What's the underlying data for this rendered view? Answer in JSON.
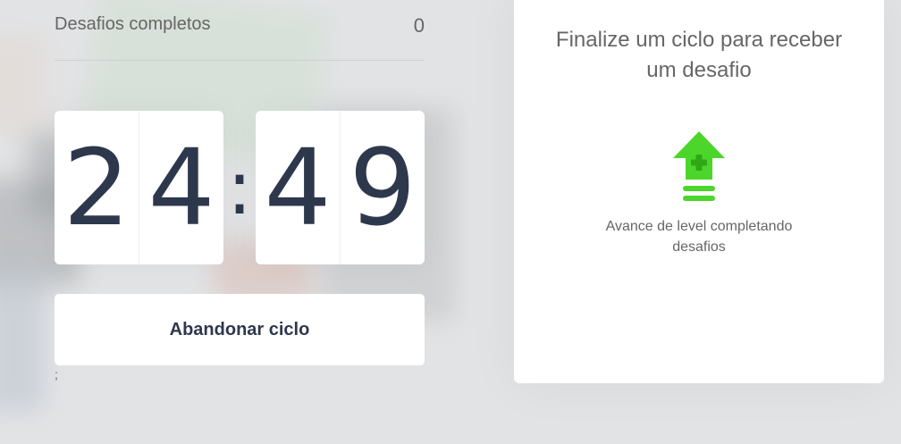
{
  "stats": {
    "label": "Desafios completos",
    "value": "0"
  },
  "timer": {
    "minutes": [
      "2",
      "4"
    ],
    "separator": ":",
    "seconds": [
      "4",
      "9"
    ]
  },
  "actions": {
    "abandon_label": "Abandonar ciclo"
  },
  "stray_text": ";",
  "challenge_box": {
    "title": "Finalize um ciclo para receber um desafio",
    "icon": "level-up-icon",
    "description": "Avance de level completando desafios"
  },
  "colors": {
    "text_dark": "#2e384d",
    "text_muted": "#666666",
    "icon_green": "#4cd62b"
  }
}
